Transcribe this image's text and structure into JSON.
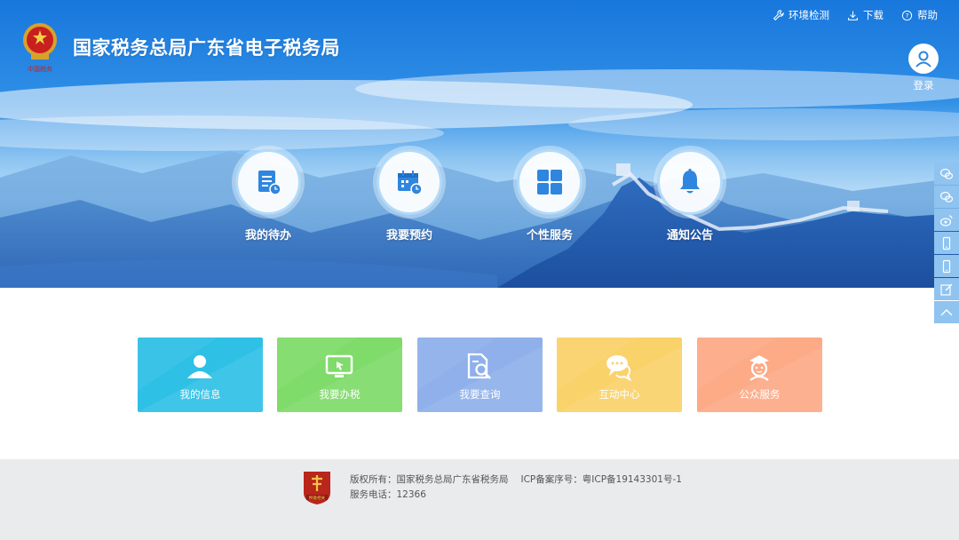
{
  "header": {
    "site_title": "国家税务总局广东省电子税务局",
    "logo_caption": "中国税务",
    "links": [
      {
        "label": "环境检测",
        "icon": "wrench-icon"
      },
      {
        "label": "下载",
        "icon": "download-icon"
      },
      {
        "label": "帮助",
        "icon": "help-icon"
      }
    ],
    "login_label": "登录"
  },
  "quick_actions": [
    {
      "label": "我的待办",
      "icon": "todo-document-icon"
    },
    {
      "label": "我要预约",
      "icon": "calendar-clock-icon"
    },
    {
      "label": "个性服务",
      "icon": "grid-icon"
    },
    {
      "label": "通知公告",
      "icon": "bell-icon"
    }
  ],
  "tiles": [
    {
      "label": "我的信息",
      "icon": "user-icon",
      "color": "#2fc0e6"
    },
    {
      "label": "我要办税",
      "icon": "monitor-icon",
      "color": "#7fdb6a"
    },
    {
      "label": "我要查询",
      "icon": "search-document-icon",
      "color": "#8fb0ea"
    },
    {
      "label": "互动中心",
      "icon": "chat-bubbles-icon",
      "color": "#fad26a"
    },
    {
      "label": "公众服务",
      "icon": "service-person-icon",
      "color": "#fdaa86"
    }
  ],
  "sidebar": [
    "wechat-icon",
    "wechat-icon",
    "weibo-icon",
    "mobile-icon",
    "mobile-icon",
    "edit-icon",
    "scroll-top-icon"
  ],
  "footer": {
    "copyright": "版权所有：国家税务总局广东省税务局",
    "icp": "ICP备案序号：粤ICP备19143301号-1",
    "phone": "服务电话：12366",
    "logo_caption": "税徽相关"
  }
}
